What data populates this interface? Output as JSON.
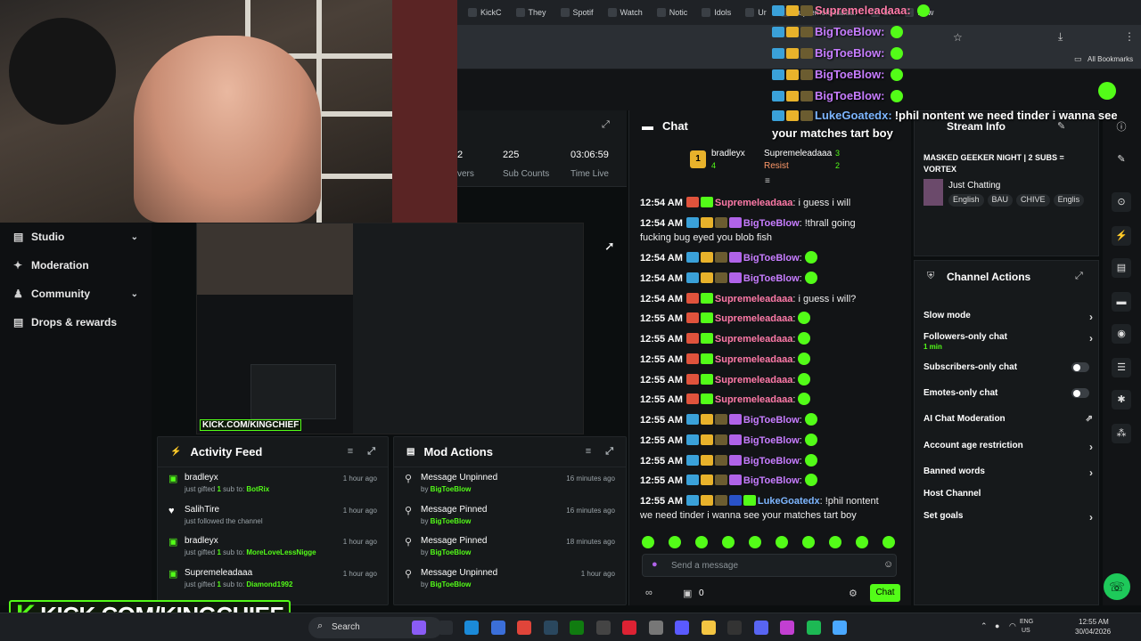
{
  "browser": {
    "tabs": [
      "KickC",
      "They",
      "Spotif",
      "Watch",
      "Notic",
      "Idols",
      "Ur",
      "Supremeleadaaa:",
      "St",
      "New"
    ],
    "bookmarks_label": "All Bookmarks"
  },
  "sidebar": {
    "items": [
      {
        "label": "Studio",
        "has_chevron": true
      },
      {
        "label": "Moderation",
        "has_chevron": false
      },
      {
        "label": "Community",
        "has_chevron": true
      },
      {
        "label": "Drops & rewards",
        "has_chevron": false
      }
    ]
  },
  "stats": {
    "viewers_value": "2",
    "viewers_label": "vers",
    "sub_counts_value": "225",
    "sub_counts_label": "Sub Counts",
    "time_live_value": "03:06:59",
    "time_live_label": "Time Live"
  },
  "activity_feed": {
    "title": "Activity Feed",
    "items": [
      {
        "name": "bradleyx",
        "pre": "just gifted ",
        "count": "1",
        "mid": " sub to: ",
        "target": "BotRix",
        "time": "1 hour ago"
      },
      {
        "name": "SalihTire",
        "pre": "just followed the channel",
        "count": "",
        "mid": "",
        "target": "",
        "time": "1 hour ago"
      },
      {
        "name": "bradleyx",
        "pre": "just gifted ",
        "count": "1",
        "mid": " sub to: ",
        "target": "MoreLoveLessNigge",
        "time": "1 hour ago"
      },
      {
        "name": "Supremeleadaaa",
        "pre": "just gifted ",
        "count": "1",
        "mid": " sub to: ",
        "target": "Diamond1992",
        "time": "1 hour ago"
      }
    ]
  },
  "mod_actions": {
    "title": "Mod Actions",
    "items": [
      {
        "action": "Message Unpinned",
        "by": "by ",
        "user": "BigToeBlow",
        "time": "16 minutes ago"
      },
      {
        "action": "Message Pinned",
        "by": "by ",
        "user": "BigToeBlow",
        "time": "16 minutes ago"
      },
      {
        "action": "Message Pinned",
        "by": "by ",
        "user": "BigToeBlow",
        "time": "18 minutes ago"
      },
      {
        "action": "Message Unpinned",
        "by": "by ",
        "user": "BigToeBlow",
        "time": "1 hour ago"
      }
    ]
  },
  "chat": {
    "title": "Chat",
    "leaderboard": [
      {
        "name": "bradleyx",
        "count": "4"
      },
      {
        "name": "Supremeleadaaa",
        "count": "3"
      },
      {
        "name": "Resist",
        "count": "2"
      }
    ],
    "messages": [
      {
        "time": "12:54 AM",
        "user": "Supremeleadaaa",
        "color": "pink",
        "text": "i guess i will"
      },
      {
        "time": "12:54 AM",
        "user": "BigToeBlow",
        "color": "purple",
        "text": "!thrall going fucking bug eyed you blob fish"
      },
      {
        "time": "12:54 AM",
        "user": "BigToeBlow",
        "color": "purple",
        "text": ""
      },
      {
        "time": "12:54 AM",
        "user": "BigToeBlow",
        "color": "purple",
        "text": ""
      },
      {
        "time": "12:54 AM",
        "user": "Supremeleadaaa",
        "color": "pink",
        "text": "i guess i will?"
      },
      {
        "time": "12:55 AM",
        "user": "Supremeleadaaa",
        "color": "pink",
        "text": ""
      },
      {
        "time": "12:55 AM",
        "user": "Supremeleadaaa",
        "color": "pink",
        "text": ""
      },
      {
        "time": "12:55 AM",
        "user": "Supremeleadaaa",
        "color": "pink",
        "text": ""
      },
      {
        "time": "12:55 AM",
        "user": "Supremeleadaaa",
        "color": "pink",
        "text": ""
      },
      {
        "time": "12:55 AM",
        "user": "Supremeleadaaa",
        "color": "pink",
        "text": ""
      },
      {
        "time": "12:55 AM",
        "user": "BigToeBlow",
        "color": "purple",
        "text": ""
      },
      {
        "time": "12:55 AM",
        "user": "BigToeBlow",
        "color": "purple",
        "text": ""
      },
      {
        "time": "12:55 AM",
        "user": "BigToeBlow",
        "color": "purple",
        "text": ""
      },
      {
        "time": "12:55 AM",
        "user": "BigToeBlow",
        "color": "purple",
        "text": ""
      },
      {
        "time": "12:55 AM",
        "user": "LukeGoatedx",
        "color": "blue",
        "text": "!phil nontent we need tinder i wanna see your matches tart boy"
      }
    ],
    "input_placeholder": "Send a message",
    "points_value": "0",
    "send_label": "Chat"
  },
  "stream_info": {
    "title": "Stream Info",
    "stream_title": "MASKED GEEKER NIGHT | 2 SUBS = VORTEX",
    "category": "Just Chatting",
    "tags": [
      "English",
      "BAU",
      "CHIVE",
      "Englis"
    ]
  },
  "channel_actions": {
    "title": "Channel Actions",
    "items": [
      {
        "label": "Slow mode",
        "sub": "",
        "control": "arrow"
      },
      {
        "label": "Followers-only chat",
        "sub": "1 min",
        "control": "arrow"
      },
      {
        "label": "Subscribers-only chat",
        "sub": "",
        "control": "toggle"
      },
      {
        "label": "Emotes-only chat",
        "sub": "",
        "control": "toggle"
      },
      {
        "label": "AI Chat Moderation",
        "sub": "",
        "control": "external"
      },
      {
        "label": "Account age restriction",
        "sub": "",
        "control": "arrow"
      },
      {
        "label": "Banned words",
        "sub": "",
        "control": "arrow"
      },
      {
        "label": "Host Channel",
        "sub": "",
        "control": "none"
      },
      {
        "label": "Set goals",
        "sub": "",
        "control": "arrow"
      }
    ]
  },
  "overlay_chat": [
    {
      "user": "Supremeleadaaa:",
      "text": ""
    },
    {
      "user": "BigToeBlow:",
      "text": ""
    },
    {
      "user": "BigToeBlow:",
      "text": ""
    },
    {
      "user": "BigToeBlow:",
      "text": ""
    },
    {
      "user": "BigToeBlow:",
      "text": ""
    },
    {
      "user": "LukeGoatedx:",
      "text": "!phil nontent we need tinder i wanna see your matches tart boy"
    }
  ],
  "kick_banner": "KICK.COM/KINGCHIEF",
  "preview_banner": "KICK.COM/KINGCHIEF",
  "taskbar": {
    "search_label": "Search",
    "lang": "ENG",
    "region": "US",
    "time": "12:55 AM",
    "date": "30/04/2026"
  },
  "colors": {
    "accent": "#53fc18",
    "pink_user": "#ff7aa8",
    "purple_user": "#c77dff",
    "blue_user": "#7db6ff"
  }
}
